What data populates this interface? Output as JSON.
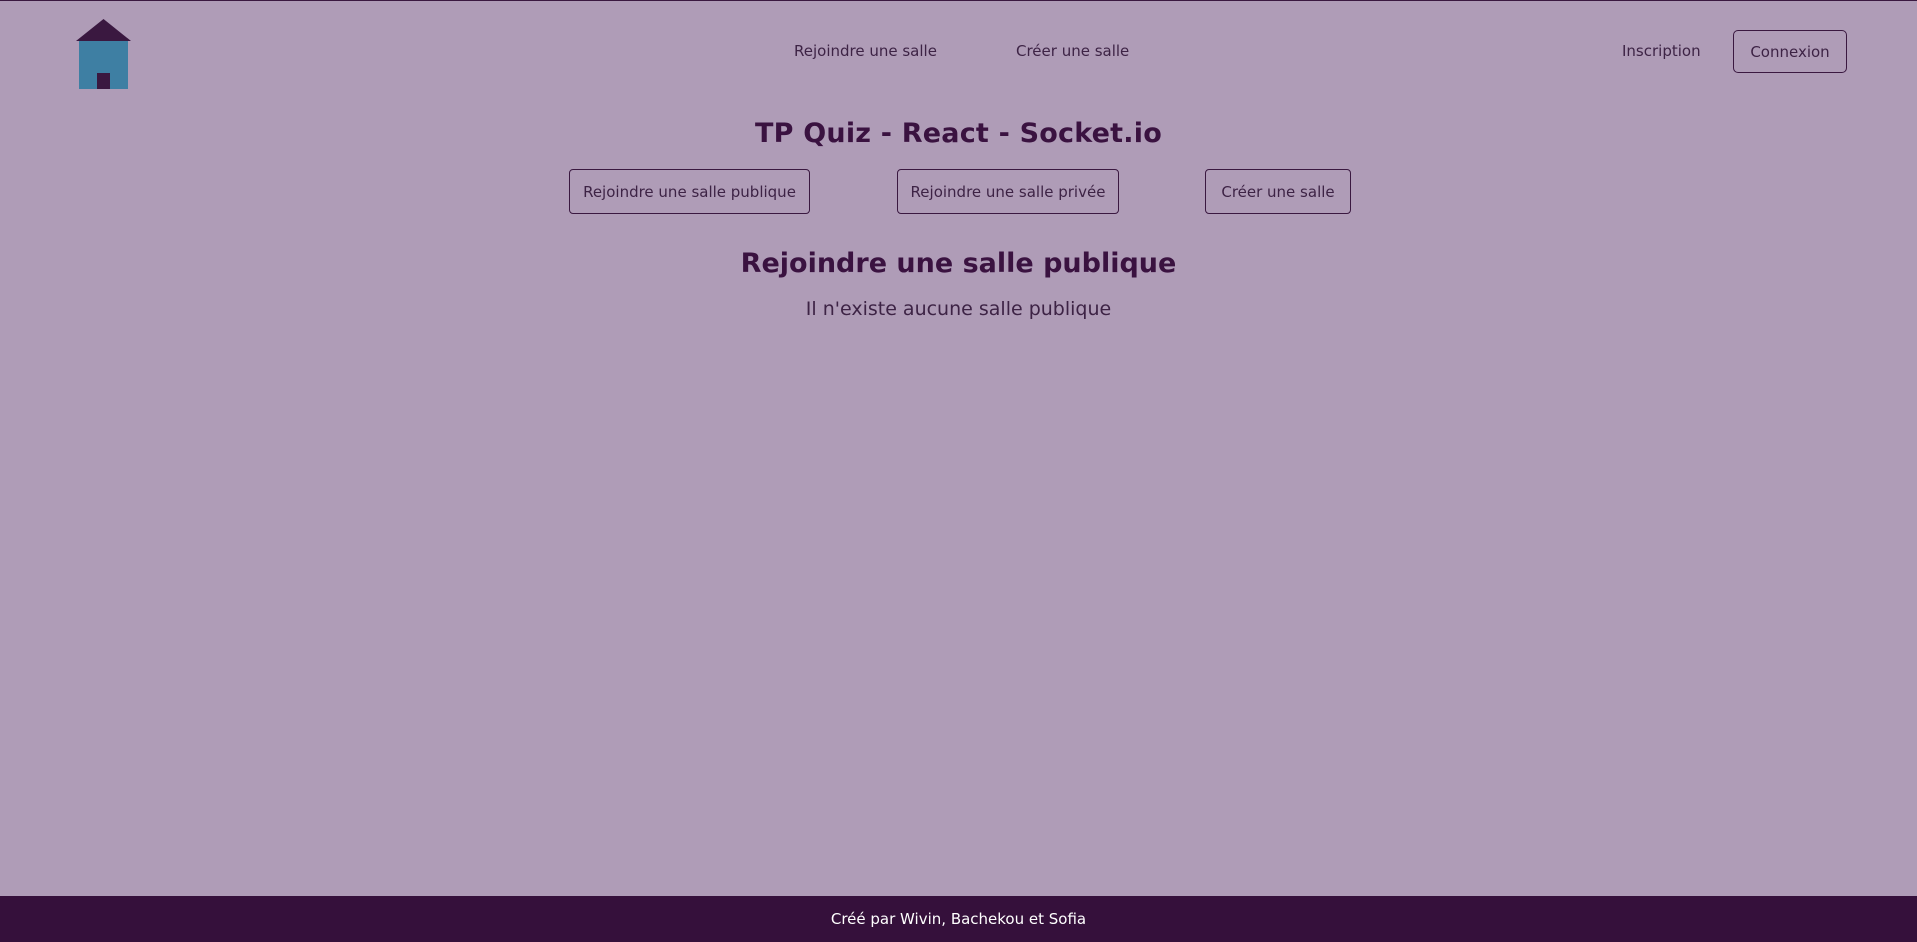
{
  "colors": {
    "background": "#af9cb7",
    "text_dark": "#3a1240",
    "footer_bg": "#35103b",
    "logo_roof": "#3a1840",
    "logo_body": "#3e7fa3",
    "logo_door": "#3a1840"
  },
  "header": {
    "logo_icon": "house-icon",
    "nav": {
      "join_label": "Rejoindre une salle",
      "create_label": "Créer une salle"
    },
    "auth": {
      "signup_label": "Inscription",
      "login_label": "Connexion"
    }
  },
  "main": {
    "title": "TP Quiz - React - Socket.io",
    "tabs": {
      "public_label": "Rejoindre une salle publique",
      "private_label": "Rejoindre une salle privée",
      "create_label": "Créer une salle"
    },
    "section_title": "Rejoindre une salle publique",
    "empty_message": "Il n'existe aucune salle publique"
  },
  "footer": {
    "credits": "Créé par Wivin, Bachekou et Sofia"
  }
}
